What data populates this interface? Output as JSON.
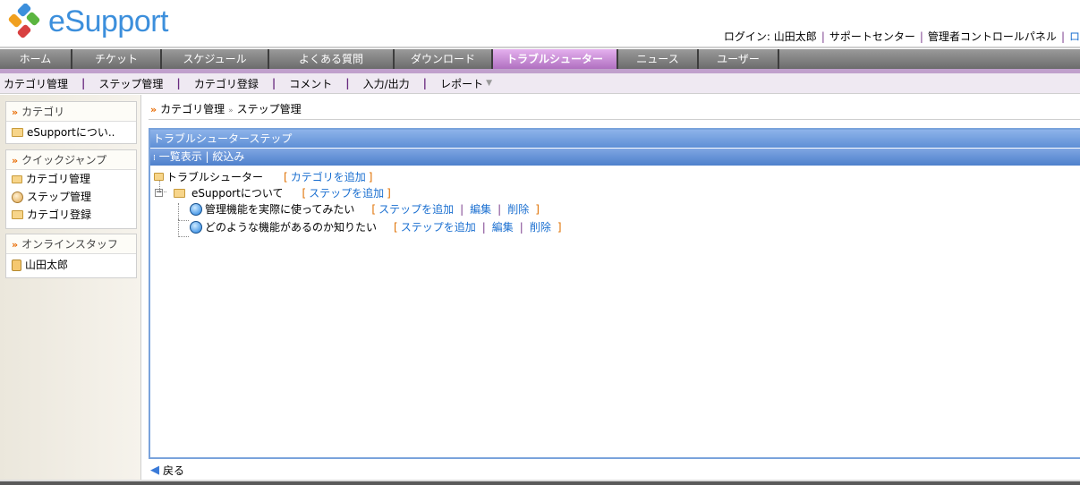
{
  "logo": {
    "text": "eSupport"
  },
  "top_links": {
    "login_label": "ログイン:",
    "user": "山田太郎",
    "support_center": "サポートセンター",
    "admin_panel": "管理者コントロールパネル",
    "logout_partial": "ロ"
  },
  "tabs": [
    {
      "label": "ホーム"
    },
    {
      "label": "チケット"
    },
    {
      "label": "スケジュール"
    },
    {
      "label": "よくある質問"
    },
    {
      "label": "ダウンロード"
    },
    {
      "label": "トラブルシューター",
      "active": true
    },
    {
      "label": "ニュース"
    },
    {
      "label": "ユーザー"
    }
  ],
  "subnav": [
    "カテゴリ管理",
    "ステップ管理",
    "カテゴリ登録",
    "コメント",
    "入力/出力",
    "レポート"
  ],
  "sidebar": {
    "category": {
      "title": "カテゴリ",
      "items": [
        "eSupportについ.."
      ]
    },
    "quickjump": {
      "title": "クイックジャンプ",
      "items": [
        "カテゴリ管理",
        "ステップ管理",
        "カテゴリ登録"
      ]
    },
    "staff": {
      "title": "オンラインスタッフ",
      "items": [
        "山田太郎"
      ]
    }
  },
  "breadcrumb": [
    "カテゴリ管理",
    "ステップ管理"
  ],
  "panel": {
    "title": "トラブルシューターステップ",
    "toolbar": {
      "list": "一覧表示",
      "filter": "絞込み"
    },
    "tree": {
      "root": "トラブルシューター",
      "root_action": "カテゴリを追加",
      "category": "eSupportについて",
      "category_action": "ステップを追加",
      "steps": [
        {
          "label": "管理機能を実際に使ってみたい"
        },
        {
          "label": "どのような機能があるのか知りたい"
        }
      ],
      "step_actions": {
        "add": "ステップを追加",
        "edit": "編集",
        "delete": "削除"
      }
    }
  },
  "back": "戻る",
  "colors": {
    "accent": "#3c8fdc",
    "active_tab": "#c586d4",
    "panel_blue": "#5e8fd6",
    "link": "#1a6fd0"
  }
}
